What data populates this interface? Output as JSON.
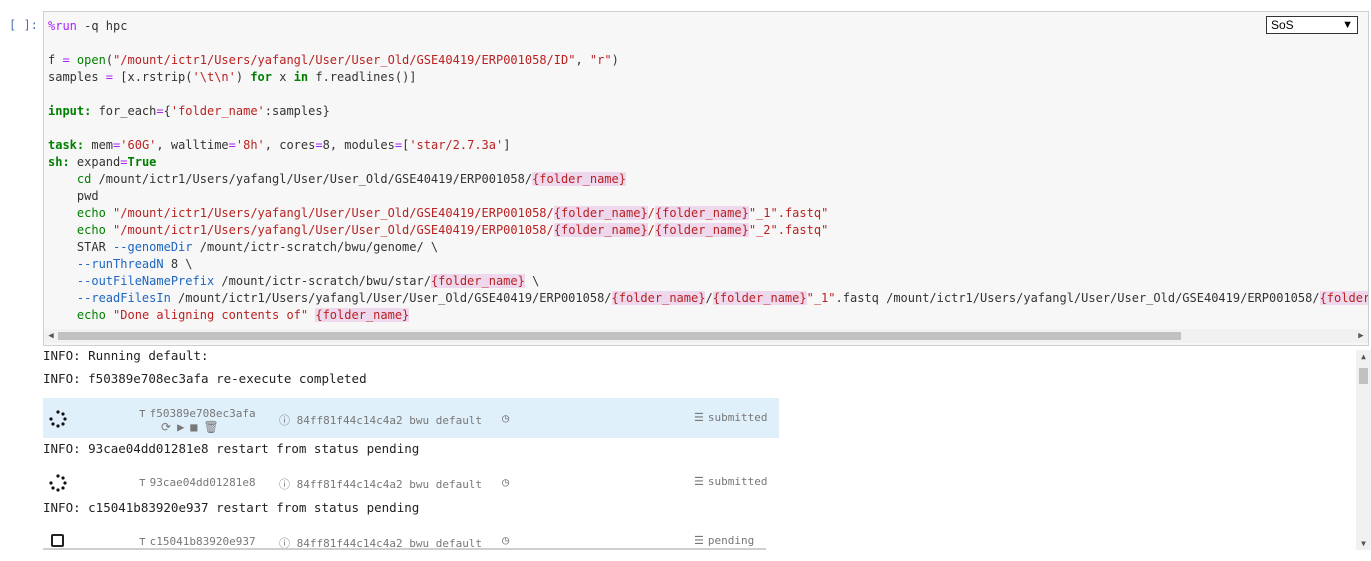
{
  "cell": {
    "prompt": "[ ]:",
    "kernel": "SoS"
  },
  "code_lines": [
    "%run -q hpc",
    "",
    "f = open(\"/mount/ictr1/Users/yafangl/User/User_Old/GSE40419/ERP001058/ID\", \"r\")",
    "samples = [x.rstrip('\\t\\n') for x in f.readlines()]",
    "",
    "input: for_each={'folder_name':samples}",
    "",
    "task: mem='60G', walltime='8h', cores=8, modules=['star/2.7.3a']",
    "sh: expand=True",
    "    cd /mount/ictr1/Users/yafangl/User/User_Old/GSE40419/ERP001058/{folder_name}",
    "    pwd",
    "    echo \"/mount/ictr1/Users/yafangl/User/User_Old/GSE40419/ERP001058/{folder_name}/{folder_name}\"_1\".fastq\"",
    "    echo \"/mount/ictr1/Users/yafangl/User/User_Old/GSE40419/ERP001058/{folder_name}/{folder_name}\"_2\".fastq\"",
    "    STAR --genomeDir /mount/ictr-scratch/bwu/genome/ \\",
    "    --runThreadN 8 \\",
    "    --outFileNamePrefix /mount/ictr-scratch/bwu/star/{folder_name} \\",
    "    --readFilesIn /mount/ictr1/Users/yafangl/User/User_Old/GSE40419/ERP001058/{folder_name}/{folder_name}\"_1\".fastq /mount/ictr1/Users/yafangl/User/User_Old/GSE40419/ERP001058/{folder_n",
    "    echo \"Done aligning contents of\" {folder_name}"
  ],
  "output": {
    "info_lines": [
      "INFO: Running default:",
      "INFO: f50389e708ec3afa re-execute completed",
      "INFO: 93cae04dd01281e8 restart from status pending",
      "INFO: c15041b83920e937 restart from status pending"
    ],
    "tasks": [
      {
        "id": "f50389e708ec3afa",
        "host": "84ff81f44c14c4a2 bwu default",
        "status": "submitted"
      },
      {
        "id": "93cae04dd01281e8",
        "host": "84ff81f44c14c4a2 bwu default",
        "status": "submitted"
      },
      {
        "id": "c15041b83920e937",
        "host": "84ff81f44c14c4a2 bwu default",
        "status": "pending"
      }
    ]
  },
  "icons": {
    "task_id": "sitemap-icon",
    "info": "info-circle-icon",
    "clock": "clock-icon",
    "status": "list-check-icon",
    "actions": [
      "refresh-icon",
      "play-icon",
      "stop-icon",
      "trash-icon"
    ],
    "running": "spinner-icon",
    "pending": "checkbox-icon"
  }
}
